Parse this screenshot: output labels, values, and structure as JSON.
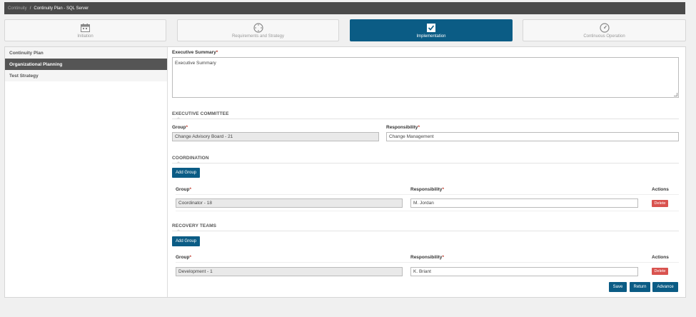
{
  "breadcrumb": {
    "parent": "Continuity",
    "separator": "/",
    "current": "Continuity Plan - SQL Server"
  },
  "steps": [
    {
      "label": "Initiation",
      "icon": "calendar-icon"
    },
    {
      "label": "Requirements and Strategy",
      "icon": "compass-icon"
    },
    {
      "label": "Implementation",
      "icon": "checkbox-icon"
    },
    {
      "label": "Continuous Operation",
      "icon": "gauge-icon"
    }
  ],
  "sidebar": {
    "items": [
      {
        "label": "Continuity Plan"
      },
      {
        "label": "Organizational Planning"
      },
      {
        "label": "Test Strategy"
      }
    ]
  },
  "executive_summary": {
    "label": "Executive Summary",
    "required_mark": "*",
    "value": "Executive Summary"
  },
  "executive_committee": {
    "title": "EXECUTIVE COMMITTEE",
    "group_label": "Group",
    "group_value": "Change Advisory Board  - 21",
    "responsibility_label": "Responsibility",
    "responsibility_value": "Change Management"
  },
  "coordination": {
    "title": "COORDINATION",
    "add_button": "Add Group",
    "col_group": "Group",
    "col_responsibility": "Responsibility",
    "col_actions": "Actions",
    "rows": [
      {
        "group": "Coordinator - 18",
        "responsibility": "M. Jordan",
        "delete": "Delete"
      }
    ]
  },
  "recovery_teams": {
    "title": "RECOVERY TEAMS",
    "add_button": "Add Group",
    "col_group": "Group",
    "col_responsibility": "Responsibility",
    "col_actions": "Actions",
    "rows": [
      {
        "group": "Development - 1",
        "responsibility": "K. Briant",
        "delete": "Delete"
      }
    ]
  },
  "footer": {
    "save": "Save",
    "return": "Return",
    "advance": "Advance"
  },
  "colors": {
    "accent": "#0b5c85",
    "danger": "#d9534f",
    "required": "#c0392b"
  }
}
